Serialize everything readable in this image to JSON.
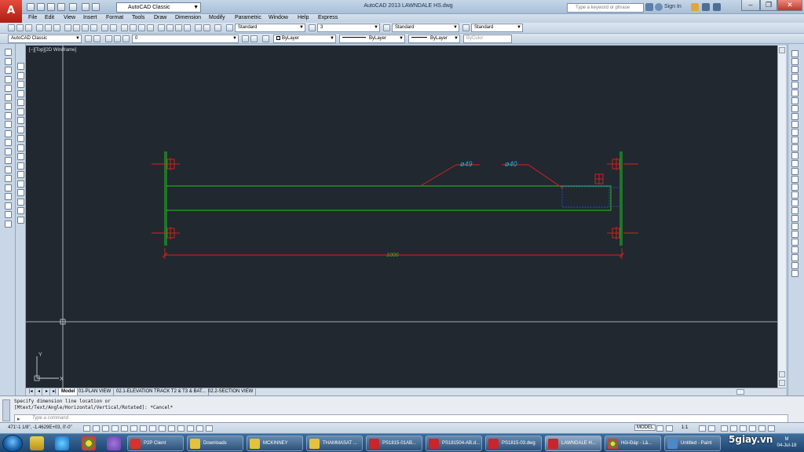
{
  "app": {
    "logo_text": "A",
    "window_title": "AutoCAD 2013    LAWNDALE HS.dwg",
    "workspace": "AutoCAD Classic",
    "search_placeholder": "Type a keyword or phrase",
    "sign_in": "Sign In",
    "minimize": "–",
    "maximize": "❐",
    "close": "✕"
  },
  "menu": [
    "File",
    "Edit",
    "View",
    "Insert",
    "Format",
    "Tools",
    "Draw",
    "Dimension",
    "Modify",
    "Parametric",
    "Window",
    "Help",
    "Express"
  ],
  "toolbar2": {
    "text_style": "Standard",
    "dim_value": "3",
    "dim_style": "Standard",
    "table_style": "Standard"
  },
  "toolbar3": {
    "workspace": "AutoCAD Classic",
    "layer": "0",
    "color": "ByLayer",
    "linetype": "ByLayer",
    "lineweight": "ByLayer",
    "plot_style": "ByColor"
  },
  "viewport": {
    "label": "[−][Top][2D Wireframe]",
    "dim_diameter_1": "ø49",
    "dim_diameter_2": "ø40",
    "dim_length": "1000",
    "ucs_y": "Y",
    "ucs_x": "X"
  },
  "layout_tabs": [
    "Model",
    "01-PLAN VIEW",
    "02.1-ELEVATION TRACK T2 & T3 & BAT...",
    "02.2-SECTION VIEW"
  ],
  "command": {
    "history_line1": "Specify dimension line location or",
    "history_line2": "[Mtext/Text/Angle/Horizontal/Vertical/Rotated]: *Cancel*",
    "input_placeholder": "Type a command"
  },
  "status": {
    "coords": "471'-1 1/8\",  -1.4629E+03, 0'-0\"",
    "model": "MODEL",
    "scale": "1:1"
  },
  "taskbar": {
    "items": [
      "P2P Client",
      "Downloads",
      "MCKINNEY",
      "THAMMASAT ...",
      "PS1815-01AB...",
      "PS181504-AB.d...",
      "PS1815-03.dwg",
      "LAWNDALE H...",
      "Hỏi-Đáp - Lả...",
      "Untitled - Paint"
    ],
    "time": "M",
    "date": "04-Jul-18"
  },
  "watermark": "5giay.vn",
  "colors": {
    "canvas_bg": "#212830",
    "geometry": "#1fc21f",
    "dimension": "#e0201c",
    "dim_text": "#00bcd4",
    "hidden": "#2c4fd8"
  }
}
